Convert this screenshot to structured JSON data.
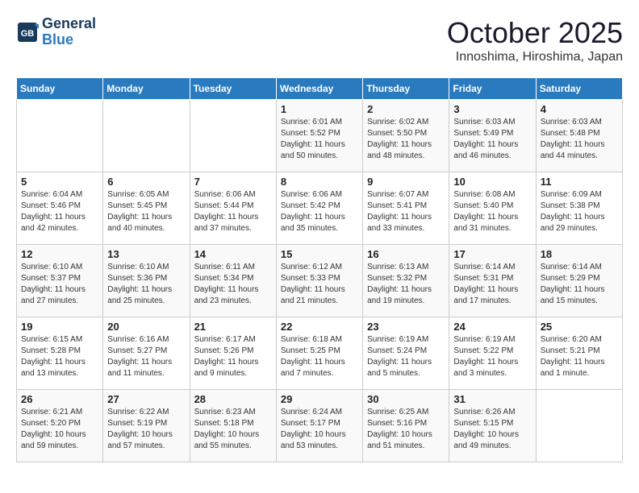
{
  "header": {
    "logo_line1": "General",
    "logo_line2": "Blue",
    "month": "October 2025",
    "location": "Innoshima, Hiroshima, Japan"
  },
  "weekdays": [
    "Sunday",
    "Monday",
    "Tuesday",
    "Wednesday",
    "Thursday",
    "Friday",
    "Saturday"
  ],
  "weeks": [
    [
      {
        "day": "",
        "info": ""
      },
      {
        "day": "",
        "info": ""
      },
      {
        "day": "",
        "info": ""
      },
      {
        "day": "1",
        "info": "Sunrise: 6:01 AM\nSunset: 5:52 PM\nDaylight: 11 hours\nand 50 minutes."
      },
      {
        "day": "2",
        "info": "Sunrise: 6:02 AM\nSunset: 5:50 PM\nDaylight: 11 hours\nand 48 minutes."
      },
      {
        "day": "3",
        "info": "Sunrise: 6:03 AM\nSunset: 5:49 PM\nDaylight: 11 hours\nand 46 minutes."
      },
      {
        "day": "4",
        "info": "Sunrise: 6:03 AM\nSunset: 5:48 PM\nDaylight: 11 hours\nand 44 minutes."
      }
    ],
    [
      {
        "day": "5",
        "info": "Sunrise: 6:04 AM\nSunset: 5:46 PM\nDaylight: 11 hours\nand 42 minutes."
      },
      {
        "day": "6",
        "info": "Sunrise: 6:05 AM\nSunset: 5:45 PM\nDaylight: 11 hours\nand 40 minutes."
      },
      {
        "day": "7",
        "info": "Sunrise: 6:06 AM\nSunset: 5:44 PM\nDaylight: 11 hours\nand 37 minutes."
      },
      {
        "day": "8",
        "info": "Sunrise: 6:06 AM\nSunset: 5:42 PM\nDaylight: 11 hours\nand 35 minutes."
      },
      {
        "day": "9",
        "info": "Sunrise: 6:07 AM\nSunset: 5:41 PM\nDaylight: 11 hours\nand 33 minutes."
      },
      {
        "day": "10",
        "info": "Sunrise: 6:08 AM\nSunset: 5:40 PM\nDaylight: 11 hours\nand 31 minutes."
      },
      {
        "day": "11",
        "info": "Sunrise: 6:09 AM\nSunset: 5:38 PM\nDaylight: 11 hours\nand 29 minutes."
      }
    ],
    [
      {
        "day": "12",
        "info": "Sunrise: 6:10 AM\nSunset: 5:37 PM\nDaylight: 11 hours\nand 27 minutes."
      },
      {
        "day": "13",
        "info": "Sunrise: 6:10 AM\nSunset: 5:36 PM\nDaylight: 11 hours\nand 25 minutes."
      },
      {
        "day": "14",
        "info": "Sunrise: 6:11 AM\nSunset: 5:34 PM\nDaylight: 11 hours\nand 23 minutes."
      },
      {
        "day": "15",
        "info": "Sunrise: 6:12 AM\nSunset: 5:33 PM\nDaylight: 11 hours\nand 21 minutes."
      },
      {
        "day": "16",
        "info": "Sunrise: 6:13 AM\nSunset: 5:32 PM\nDaylight: 11 hours\nand 19 minutes."
      },
      {
        "day": "17",
        "info": "Sunrise: 6:14 AM\nSunset: 5:31 PM\nDaylight: 11 hours\nand 17 minutes."
      },
      {
        "day": "18",
        "info": "Sunrise: 6:14 AM\nSunset: 5:29 PM\nDaylight: 11 hours\nand 15 minutes."
      }
    ],
    [
      {
        "day": "19",
        "info": "Sunrise: 6:15 AM\nSunset: 5:28 PM\nDaylight: 11 hours\nand 13 minutes."
      },
      {
        "day": "20",
        "info": "Sunrise: 6:16 AM\nSunset: 5:27 PM\nDaylight: 11 hours\nand 11 minutes."
      },
      {
        "day": "21",
        "info": "Sunrise: 6:17 AM\nSunset: 5:26 PM\nDaylight: 11 hours\nand 9 minutes."
      },
      {
        "day": "22",
        "info": "Sunrise: 6:18 AM\nSunset: 5:25 PM\nDaylight: 11 hours\nand 7 minutes."
      },
      {
        "day": "23",
        "info": "Sunrise: 6:19 AM\nSunset: 5:24 PM\nDaylight: 11 hours\nand 5 minutes."
      },
      {
        "day": "24",
        "info": "Sunrise: 6:19 AM\nSunset: 5:22 PM\nDaylight: 11 hours\nand 3 minutes."
      },
      {
        "day": "25",
        "info": "Sunrise: 6:20 AM\nSunset: 5:21 PM\nDaylight: 11 hours\nand 1 minute."
      }
    ],
    [
      {
        "day": "26",
        "info": "Sunrise: 6:21 AM\nSunset: 5:20 PM\nDaylight: 10 hours\nand 59 minutes."
      },
      {
        "day": "27",
        "info": "Sunrise: 6:22 AM\nSunset: 5:19 PM\nDaylight: 10 hours\nand 57 minutes."
      },
      {
        "day": "28",
        "info": "Sunrise: 6:23 AM\nSunset: 5:18 PM\nDaylight: 10 hours\nand 55 minutes."
      },
      {
        "day": "29",
        "info": "Sunrise: 6:24 AM\nSunset: 5:17 PM\nDaylight: 10 hours\nand 53 minutes."
      },
      {
        "day": "30",
        "info": "Sunrise: 6:25 AM\nSunset: 5:16 PM\nDaylight: 10 hours\nand 51 minutes."
      },
      {
        "day": "31",
        "info": "Sunrise: 6:26 AM\nSunset: 5:15 PM\nDaylight: 10 hours\nand 49 minutes."
      },
      {
        "day": "",
        "info": ""
      }
    ]
  ]
}
